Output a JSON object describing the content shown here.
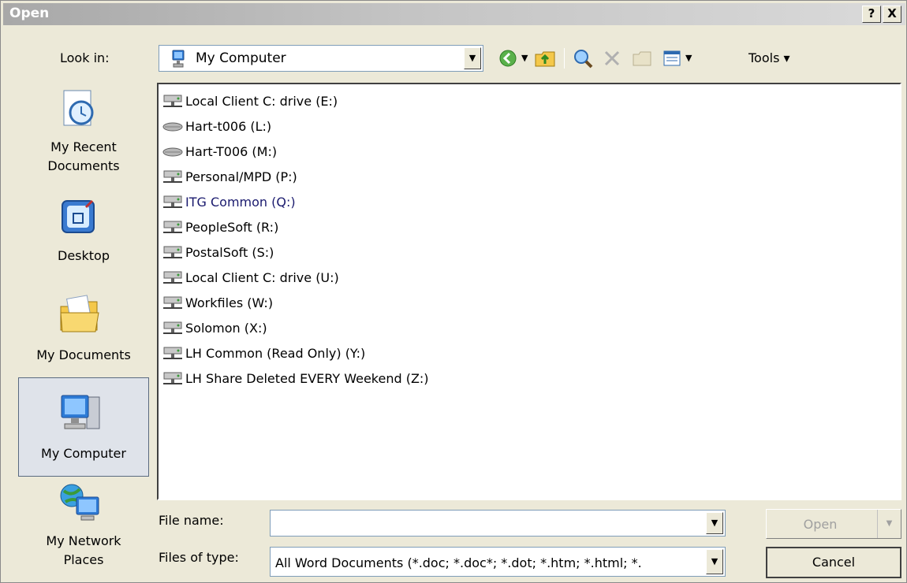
{
  "window": {
    "title": "Open",
    "help_label": "?",
    "close_label": "X"
  },
  "toolbar": {
    "lookin_label": "Look in:",
    "lookin_value": "My Computer",
    "tools_label": "Tools ▾"
  },
  "places": [
    {
      "label_line1": "My Recent",
      "label_line2": "Documents"
    },
    {
      "label_line1": "Desktop",
      "label_line2": ""
    },
    {
      "label_line1": "My Documents",
      "label_line2": ""
    },
    {
      "label_line1": "My Computer",
      "label_line2": ""
    },
    {
      "label_line1": "My Network",
      "label_line2": "Places"
    }
  ],
  "files": [
    {
      "name": "Local Client C: drive (E:)",
      "icon": "network-drive-icon"
    },
    {
      "name": "Hart-t006 (L:)",
      "icon": "disconnected-drive-icon"
    },
    {
      "name": "Hart-T006 (M:)",
      "icon": "disconnected-drive-icon"
    },
    {
      "name": "Personal/MPD (P:)",
      "icon": "network-drive-icon"
    },
    {
      "name": "ITG Common (Q:)",
      "icon": "network-drive-icon"
    },
    {
      "name": "PeopleSoft (R:)",
      "icon": "network-drive-icon"
    },
    {
      "name": "PostalSoft (S:)",
      "icon": "network-drive-icon"
    },
    {
      "name": "Local Client C: drive (U:)",
      "icon": "network-drive-icon"
    },
    {
      "name": "Workfiles (W:)",
      "icon": "network-drive-icon"
    },
    {
      "name": "Solomon (X:)",
      "icon": "network-drive-icon"
    },
    {
      "name": "LH Common (Read Only) (Y:)",
      "icon": "network-drive-icon"
    },
    {
      "name": "LH Share Deleted EVERY Weekend (Z:)",
      "icon": "network-drive-icon"
    }
  ],
  "footer": {
    "filename_label": "File name:",
    "filename_value": "",
    "filetype_label": "Files of type:",
    "filetype_value": "All Word Documents (*.doc; *.doc*; *.dot; *.htm; *.html; *.",
    "open_label": "Open",
    "cancel_label": "Cancel"
  },
  "colors": {
    "dialog_bg": "#ece9d8",
    "highlight_text": "#1a1a6e",
    "selected_place": "#dfe3ea"
  }
}
